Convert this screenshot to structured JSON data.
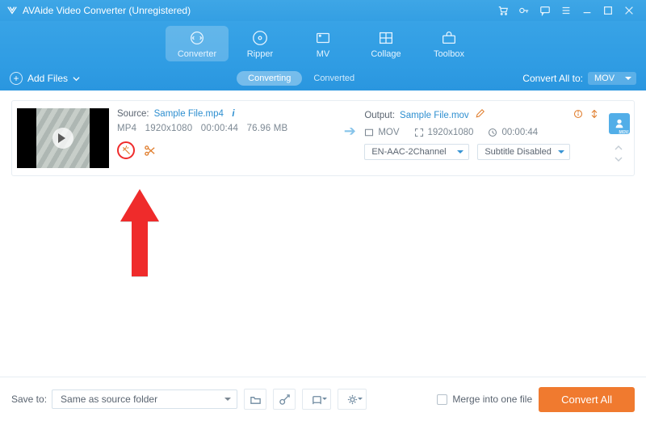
{
  "window": {
    "title": "AVAide Video Converter (Unregistered)"
  },
  "tabs": {
    "converter": "Converter",
    "ripper": "Ripper",
    "mv": "MV",
    "collage": "Collage",
    "toolbox": "Toolbox"
  },
  "subbar": {
    "add_files": "Add Files",
    "converting_tab": "Converting",
    "converted_tab": "Converted",
    "convert_all_to_label": "Convert All to:",
    "convert_all_to_value": "MOV"
  },
  "item": {
    "source_label": "Source:",
    "source_name": "Sample File.mp4",
    "src_format": "MP4",
    "src_res": "1920x1080",
    "src_dur": "00:00:44",
    "src_size": "76.96 MB",
    "output_label": "Output:",
    "output_name": "Sample File.mov",
    "out_format": "MOV",
    "out_res": "1920x1080",
    "out_dur": "00:00:44",
    "audio_select": "EN-AAC-2Channel",
    "subtitle_select": "Subtitle Disabled",
    "profile_sub": "MOV"
  },
  "footer": {
    "save_to_label": "Save to:",
    "save_to_value": "Same as source folder",
    "merge_label": "Merge into one file",
    "convert_all_btn": "Convert All"
  },
  "colors": {
    "accent_blue": "#349fe3",
    "accent_orange": "#f07a2f",
    "pointer_red": "#ef2b2b"
  }
}
